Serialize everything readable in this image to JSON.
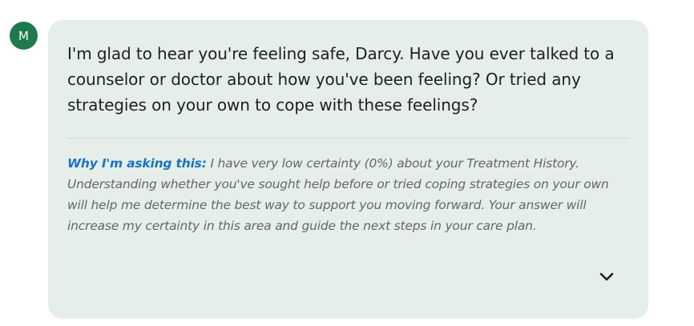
{
  "avatar": {
    "initial": "M",
    "color": "#1e7a4c"
  },
  "message": {
    "text": "I'm glad to hear you're feeling safe, Darcy. Have you ever talked to a counselor or doctor about how you've been feeling? Or tried any strategies on your own to cope with these feelings?"
  },
  "explanation": {
    "label": "Why I'm asking this:",
    "text": " I have very low certainty (0%) about your Treatment History. Understanding whether you've sought help before or tried coping strategies on your own will help me determine the best way to support you moving forward. Your answer will increase my certainty in this area and guide the next steps in your care plan.",
    "label_color": "#1a73c0"
  },
  "controls": {
    "expand_icon": "chevron-down-icon"
  },
  "colors": {
    "bubble_background": "#e6eee9"
  }
}
